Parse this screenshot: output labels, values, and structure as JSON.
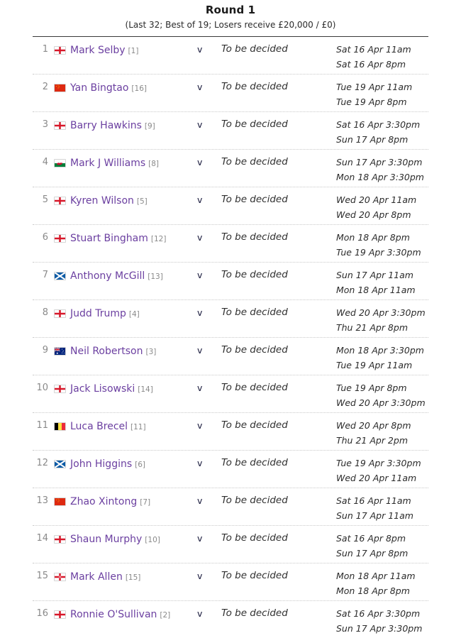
{
  "header": {
    "title": "Round 1",
    "subtitle": "(Last 32; Best of 19; Losers receive £20,000 / £0)"
  },
  "colors": {
    "player_link": "#6b3fa0",
    "row_number": "#8a8a8a",
    "seed": "#8a8a8a",
    "versus": "#16173a",
    "opponent": "#2f2f2f",
    "dates": "#2b2b2b",
    "divider": "#c9c9c9",
    "header_rule": "#3a3a3a"
  },
  "matches": [
    {
      "number": "1",
      "flag": "england",
      "player": "Mark Selby",
      "seed": "[1]",
      "versus": "v",
      "opponent": "To be decided",
      "dates": [
        "Sat 16 Apr 11am",
        "Sat 16 Apr 8pm"
      ]
    },
    {
      "number": "2",
      "flag": "china",
      "player": "Yan Bingtao",
      "seed": "[16]",
      "versus": "v",
      "opponent": "To be decided",
      "dates": [
        "Tue 19 Apr 11am",
        "Tue 19 Apr 8pm"
      ]
    },
    {
      "number": "3",
      "flag": "england",
      "player": "Barry Hawkins",
      "seed": "[9]",
      "versus": "v",
      "opponent": "To be decided",
      "dates": [
        "Sat 16 Apr 3:30pm",
        "Sun 17 Apr 8pm"
      ]
    },
    {
      "number": "4",
      "flag": "wales",
      "player": "Mark J Williams",
      "seed": "[8]",
      "versus": "v",
      "opponent": "To be decided",
      "dates": [
        "Sun 17 Apr 3:30pm",
        "Mon 18 Apr 3:30pm"
      ]
    },
    {
      "number": "5",
      "flag": "england",
      "player": "Kyren Wilson",
      "seed": "[5]",
      "versus": "v",
      "opponent": "To be decided",
      "dates": [
        "Wed 20 Apr 11am",
        "Wed 20 Apr 8pm"
      ]
    },
    {
      "number": "6",
      "flag": "england",
      "player": "Stuart Bingham",
      "seed": "[12]",
      "versus": "v",
      "opponent": "To be decided",
      "dates": [
        "Mon 18 Apr 8pm",
        "Tue 19 Apr 3:30pm"
      ]
    },
    {
      "number": "7",
      "flag": "scotland",
      "player": "Anthony McGill",
      "seed": "[13]",
      "versus": "v",
      "opponent": "To be decided",
      "dates": [
        "Sun 17 Apr 11am",
        "Mon 18 Apr 11am"
      ]
    },
    {
      "number": "8",
      "flag": "england",
      "player": "Judd Trump",
      "seed": "[4]",
      "versus": "v",
      "opponent": "To be decided",
      "dates": [
        "Wed 20 Apr 3:30pm",
        "Thu 21 Apr 8pm"
      ]
    },
    {
      "number": "9",
      "flag": "australia",
      "player": "Neil Robertson",
      "seed": "[3]",
      "versus": "v",
      "opponent": "To be decided",
      "dates": [
        "Mon 18 Apr 3:30pm",
        "Tue 19 Apr 11am"
      ]
    },
    {
      "number": "10",
      "flag": "england",
      "player": "Jack Lisowski",
      "seed": "[14]",
      "versus": "v",
      "opponent": "To be decided",
      "dates": [
        "Tue 19 Apr 8pm",
        "Wed 20 Apr 3:30pm"
      ]
    },
    {
      "number": "11",
      "flag": "belgium",
      "player": "Luca Brecel",
      "seed": "[11]",
      "versus": "v",
      "opponent": "To be decided",
      "dates": [
        "Wed 20 Apr 8pm",
        "Thu 21 Apr 2pm"
      ]
    },
    {
      "number": "12",
      "flag": "scotland",
      "player": "John Higgins",
      "seed": "[6]",
      "versus": "v",
      "opponent": "To be decided",
      "dates": [
        "Tue 19 Apr 3:30pm",
        "Wed 20 Apr 11am"
      ]
    },
    {
      "number": "13",
      "flag": "china",
      "player": "Zhao Xintong",
      "seed": "[7]",
      "versus": "v",
      "opponent": "To be decided",
      "dates": [
        "Sat 16 Apr 11am",
        "Sun 17 Apr 11am"
      ]
    },
    {
      "number": "14",
      "flag": "england",
      "player": "Shaun Murphy",
      "seed": "[10]",
      "versus": "v",
      "opponent": "To be decided",
      "dates": [
        "Sat 16 Apr 8pm",
        "Sun 17 Apr 8pm"
      ]
    },
    {
      "number": "15",
      "flag": "northern-ireland",
      "player": "Mark Allen",
      "seed": "[15]",
      "versus": "v",
      "opponent": "To be decided",
      "dates": [
        "Mon 18 Apr 11am",
        "Mon 18 Apr 8pm"
      ]
    },
    {
      "number": "16",
      "flag": "england",
      "player": "Ronnie O'Sullivan",
      "seed": "[2]",
      "versus": "v",
      "opponent": "To be decided",
      "dates": [
        "Sat 16 Apr 3:30pm",
        "Sun 17 Apr 3:30pm"
      ]
    }
  ]
}
